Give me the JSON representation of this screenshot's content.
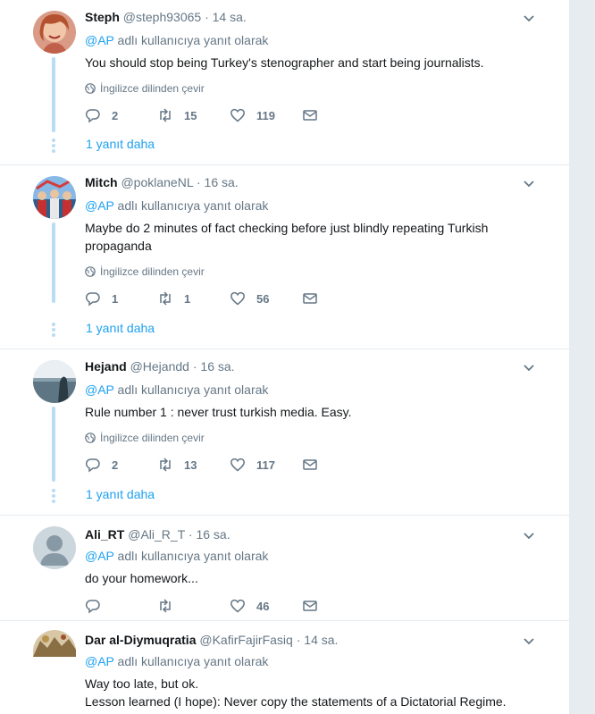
{
  "tweets": [
    {
      "name": "Steph",
      "handle": "@steph93065",
      "time": "14 sa.",
      "reply_prefix": "@AP",
      "reply_suffix": " adlı kullanıcıya yanıt olarak",
      "text": "You should stop being Turkey's stenographer and start being journalists.",
      "translate": "İngilizce dilinden çevir",
      "replies": "2",
      "retweets": "15",
      "likes": "119",
      "more": "1 yanıt daha"
    },
    {
      "name": "Mitch",
      "handle": "@poklaneNL",
      "time": "16 sa.",
      "reply_prefix": "@AP",
      "reply_suffix": " adlı kullanıcıya yanıt olarak",
      "text": "Maybe do 2 minutes of fact checking before just blindly repeating Turkish propaganda",
      "translate": "İngilizce dilinden çevir",
      "replies": "1",
      "retweets": "1",
      "likes": "56",
      "more": "1 yanıt daha"
    },
    {
      "name": "Hejand",
      "handle": "@Hejandd",
      "time": "16 sa.",
      "reply_prefix": "@AP",
      "reply_suffix": " adlı kullanıcıya yanıt olarak",
      "text": "Rule number 1 : never trust turkish media. Easy.",
      "translate": "İngilizce dilinden çevir",
      "replies": "2",
      "retweets": "13",
      "likes": "117",
      "more": "1 yanıt daha"
    },
    {
      "name": "Ali_RT",
      "handle": "@Ali_R_T",
      "time": "16 sa.",
      "reply_prefix": "@AP",
      "reply_suffix": " adlı kullanıcıya yanıt olarak",
      "text": "do your homework...",
      "replies": "",
      "retweets": "",
      "likes": "46"
    },
    {
      "name": "Dar al-Diymuqratia",
      "handle": "@KafirFajirFasiq",
      "time": "14 sa.",
      "reply_prefix": "@AP",
      "reply_suffix": " adlı kullanıcıya yanıt olarak",
      "text": "Way too late, but ok.\nLesson learned (I hope): Never copy the statements of a Dictatorial Regime."
    }
  ],
  "colors": {
    "accent": "#1da1f2",
    "muted": "#657786",
    "thread": "#b7dcf5"
  },
  "dot_separator": "·"
}
